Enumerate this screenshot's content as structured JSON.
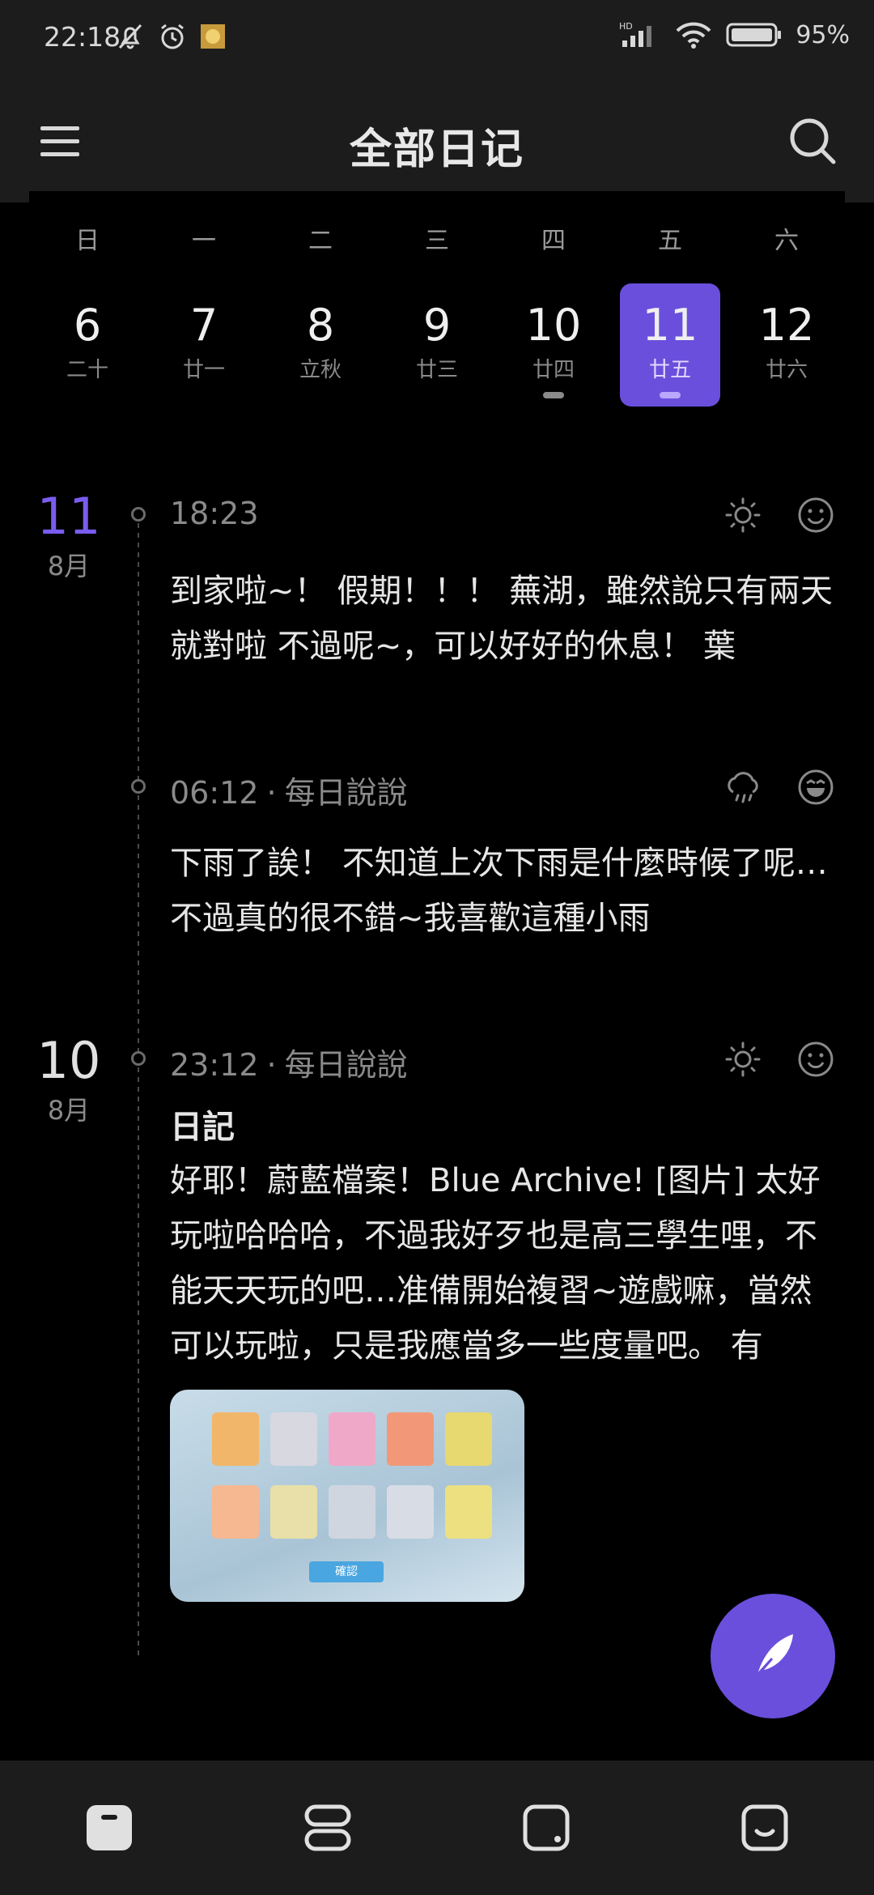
{
  "status_bar": {
    "time": "22:18",
    "network_label": "HD",
    "battery": "95%"
  },
  "header": {
    "title": "全部日记",
    "menu_icon": "menu-icon",
    "search_icon": "search-icon"
  },
  "calendar": {
    "weekdays": [
      "日",
      "一",
      "二",
      "三",
      "四",
      "五",
      "六"
    ],
    "dates": [
      {
        "day": "6",
        "lunar": "二十",
        "has_entry": false
      },
      {
        "day": "7",
        "lunar": "廿一",
        "has_entry": false
      },
      {
        "day": "8",
        "lunar": "立秋",
        "has_entry": false
      },
      {
        "day": "9",
        "lunar": "廿三",
        "has_entry": false
      },
      {
        "day": "10",
        "lunar": "廿四",
        "has_entry": true
      },
      {
        "day": "11",
        "lunar": "廿五",
        "has_entry": true,
        "selected": true
      },
      {
        "day": "12",
        "lunar": "廿六",
        "has_entry": false
      }
    ],
    "accent_color": "#6a4fdc"
  },
  "groups": [
    {
      "day": "11",
      "month": "8月",
      "highlight": true
    },
    {
      "day": "10",
      "month": "8月",
      "highlight": false
    }
  ],
  "entries": [
    {
      "time": "18:23",
      "category": "",
      "weather_icon": "sun-icon",
      "mood_icon": "smile-icon",
      "text": "到家啦~！ 假期！！！ 蕪湖，雖然說只有兩天就對啦 不過呢~，可以好好的休息！ 葉"
    },
    {
      "time": "06:12",
      "separator": "·",
      "category": "每日說說",
      "weather_icon": "rain-cloud-icon",
      "mood_icon": "laugh-icon",
      "text": "下雨了誒！ 不知道上次下雨是什麼時候了呢…不過真的很不錯~我喜歡這種小雨"
    },
    {
      "time": "23:12",
      "separator": "·",
      "category": "每日說說",
      "weather_icon": "sun-icon",
      "mood_icon": "smile-icon",
      "heading": "日記",
      "text": "好耶！蔚藍檔案！Blue Archive! [图片] 太好玩啦哈哈哈，不過我好歹也是高三學生哩，不能天天玩的吧…准備開始複習~遊戲嘛，當然可以玩啦，只是我應當多一些度量吧。 有",
      "image_icon": "game-screenshot-thumbnail",
      "image_button_text": "確認"
    }
  ],
  "fab": {
    "icon": "feather-pen-icon"
  },
  "bottom_nav": [
    {
      "icon": "diary-tab-icon",
      "active": true
    },
    {
      "icon": "list-tab-icon",
      "active": false
    },
    {
      "icon": "square-tab-icon",
      "active": false
    },
    {
      "icon": "mood-tab-icon",
      "active": false
    }
  ]
}
